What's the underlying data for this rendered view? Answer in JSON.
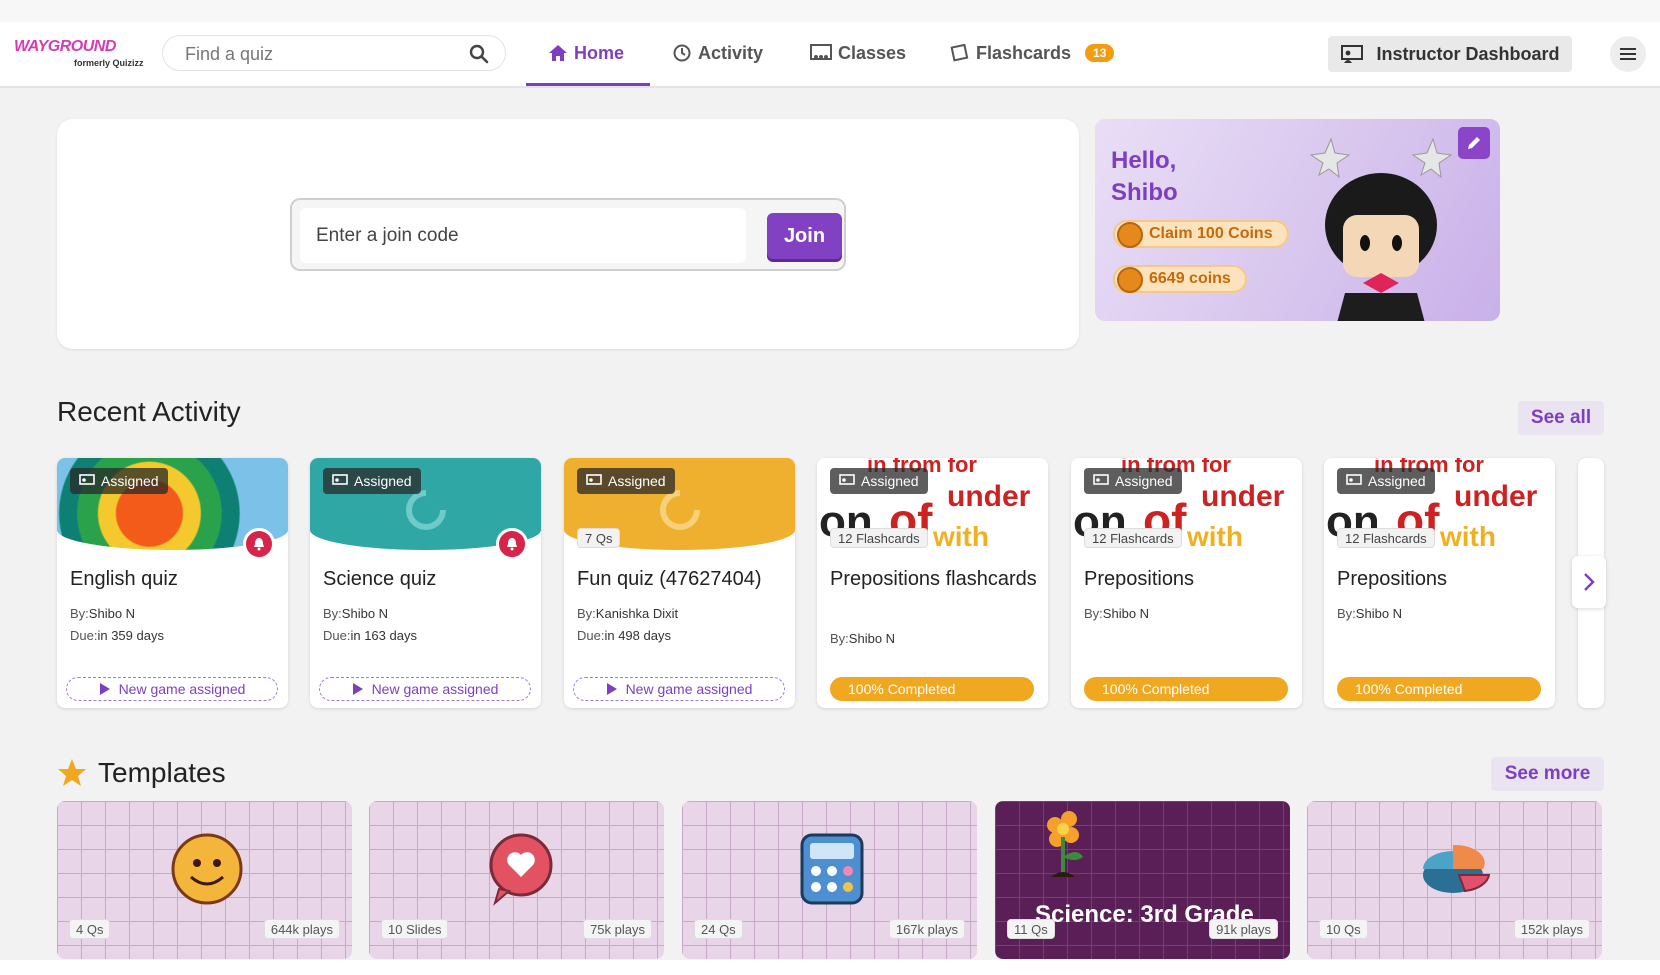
{
  "nav": {
    "brand": "WAYGROUND",
    "brand_sub": "formerly Quizizz",
    "search_placeholder": "Find a quiz",
    "items": [
      {
        "label": "Home",
        "icon": "home-icon"
      },
      {
        "label": "Activity",
        "icon": "history-icon"
      },
      {
        "label": "Classes",
        "icon": "classes-icon"
      },
      {
        "label": "Flashcards",
        "icon": "flashcards-icon",
        "badge": "13"
      }
    ],
    "instructor_label": "Instructor Dashboard"
  },
  "join": {
    "placeholder": "Enter a join code",
    "button": "Join"
  },
  "hello": {
    "greeting": "Hello,",
    "name": "Shibo",
    "claim": "Claim 100 Coins",
    "coins": "6649 coins"
  },
  "recent": {
    "title": "Recent Activity",
    "see_all": "See all",
    "cards": [
      {
        "tag": "Assigned",
        "title": "English quiz",
        "by_label": "By:",
        "by": "Shibo N",
        "due_label": "Due:",
        "due": "in 359 days",
        "footer": "New game assigned"
      },
      {
        "tag": "Assigned",
        "title": "Science quiz",
        "by_label": "By:",
        "by": "Shibo N",
        "due_label": "Due:",
        "due": "in 163 days",
        "footer": "New game assigned"
      },
      {
        "tag": "Assigned",
        "count": "7 Qs",
        "title": "Fun quiz (47627404)",
        "by_label": "By:",
        "by": "Kanishka Dixit",
        "due_label": "Due:",
        "due": "in 498 days",
        "footer": "New game assigned"
      },
      {
        "tag": "Assigned",
        "count": "12 Flashcards",
        "title": "Prepositions flashcards",
        "by_label": "By:",
        "by": "Shibo N",
        "footer": "100% Completed",
        "progress": 1.0
      },
      {
        "tag": "Assigned",
        "count": "12 Flashcards",
        "title": "Prepositions",
        "by_label": "By:",
        "by": "Shibo N",
        "footer": "100% Completed",
        "progress": 1.0
      },
      {
        "tag": "Assigned",
        "count": "12 Flashcards",
        "title": "Prepositions",
        "by_label": "By:",
        "by": "Shibo N",
        "footer": "100% Completed",
        "progress": 1.0
      }
    ]
  },
  "templates": {
    "title": "Templates",
    "see_more": "See more",
    "cards": [
      {
        "left": "4 Qs",
        "right": "644k plays",
        "icon": "smiley-icon"
      },
      {
        "left": "10 Slides",
        "right": "75k plays",
        "icon": "heart-bubble-icon"
      },
      {
        "left": "24 Qs",
        "right": "167k plays",
        "icon": "calculator-icon"
      },
      {
        "left": "11 Qs",
        "right": "91k plays",
        "icon": "flower-icon",
        "overlay": "Science: 3rd Grade"
      },
      {
        "left": "10 Qs",
        "right": "152k plays",
        "icon": "pie-chart-icon"
      }
    ]
  },
  "colors": {
    "accent": "#7d3fbf",
    "orange": "#f0a821",
    "red": "#d6244a"
  }
}
